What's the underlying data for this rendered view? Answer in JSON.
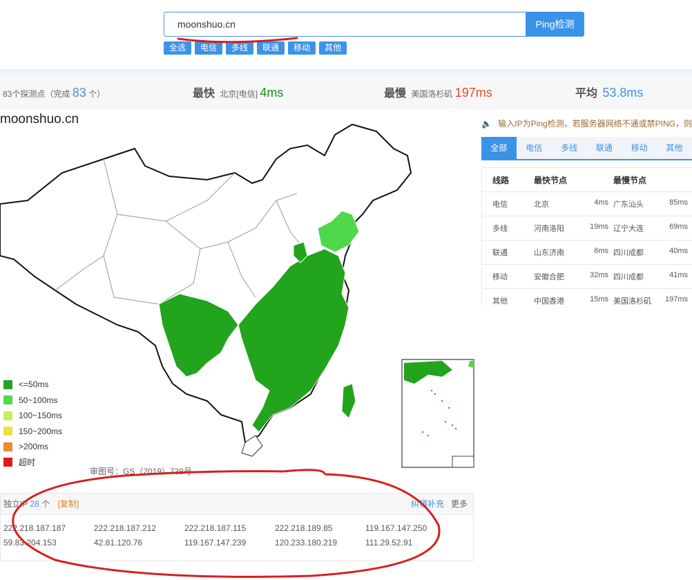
{
  "search": {
    "value": "moonshuo.cn",
    "button_label": "Ping检测"
  },
  "filters": [
    "全选",
    "电信",
    "多线",
    "联通",
    "移动",
    "其他"
  ],
  "stats": {
    "probe_text_prefix": "83个探测点（完成",
    "completed": "83",
    "probe_text_suffix": "个）",
    "fastest_label": "最快",
    "fastest_location": "北京[电信]",
    "fastest_value": "4ms",
    "slowest_label": "最慢",
    "slowest_location": "美国洛杉矶",
    "slowest_value": "197ms",
    "average_label": "平均",
    "average_value": "53.8ms"
  },
  "map": {
    "title": "moonshuo.cn",
    "caption": "审图号：GS（2019）738号",
    "legend": [
      {
        "label": "<=50ms",
        "color": "#22a41c"
      },
      {
        "label": "50~100ms",
        "color": "#4fd94a"
      },
      {
        "label": "100~150ms",
        "color": "#c4f060"
      },
      {
        "label": "150~200ms",
        "color": "#f0e040"
      },
      {
        "label": ">200ms",
        "color": "#ef8a30"
      },
      {
        "label": "超时",
        "color": "#e01a1a"
      }
    ]
  },
  "ip_panel": {
    "label": "独立IP",
    "count": "28",
    "count_unit": "个",
    "copy_label": "[复制]",
    "correct_label": "纠错补充",
    "more_label": "更多",
    "rows": [
      [
        "222.218.187.187",
        "222.218.187.212",
        "222.218.187.115",
        "222.218.189.85",
        "119.167.147.250"
      ],
      [
        "59.83.204.153",
        "42.81.120.76",
        "119.167.147.239",
        "120.233.180.219",
        "111.29.52.91"
      ]
    ]
  },
  "notice": "输入IP为Ping检测，若服务器网络不通或禁PING，则",
  "tabs": [
    "全部",
    "电信",
    "多线",
    "联通",
    "移动",
    "其他"
  ],
  "node_table": {
    "headers": [
      "线路",
      "最快节点",
      "最慢节点"
    ],
    "rows": [
      {
        "line": "电信",
        "fast_node": "北京",
        "fast_ms": "4ms",
        "slow_node": "广东汕头",
        "slow_ms": "85ms"
      },
      {
        "line": "多线",
        "fast_node": "河南洛阳",
        "fast_ms": "19ms",
        "slow_node": "辽宁大连",
        "slow_ms": "69ms"
      },
      {
        "line": "联通",
        "fast_node": "山东济南",
        "fast_ms": "6ms",
        "slow_node": "四川成都",
        "slow_ms": "40ms"
      },
      {
        "line": "移动",
        "fast_node": "安徽合肥",
        "fast_ms": "32ms",
        "slow_node": "四川成都",
        "slow_ms": "41ms"
      },
      {
        "line": "其他",
        "fast_node": "中国香港",
        "fast_ms": "15ms",
        "slow_node": "美国洛杉矶",
        "slow_ms": "197ms"
      }
    ]
  }
}
